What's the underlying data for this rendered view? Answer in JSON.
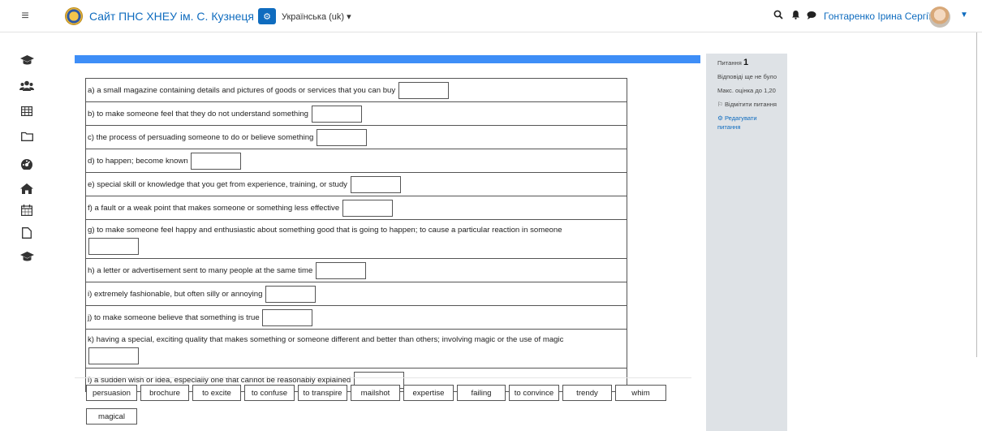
{
  "header": {
    "menu_icon": "hamburger-icon",
    "site_title": "Сайт ПНС ХНЕУ ім. С. Кузнеця",
    "language": "Українська (uk) ▾",
    "user_name": "Гонтаренко Ірина Сергіївна",
    "icons": [
      "search-icon",
      "bell-icon",
      "chat-icon",
      "chevron-down-icon"
    ]
  },
  "sidebar": {
    "icons": [
      "graduation-cap-icon",
      "users-icon",
      "grid-icon",
      "folder-icon",
      "dashboard-icon",
      "home-icon",
      "calendar-icon",
      "file-icon",
      "graduation-cap-icon"
    ]
  },
  "info": {
    "question_label": "Питання",
    "question_number": "1",
    "status": "Відповіді ще не було",
    "max_score": "Макс. оцінка до 1,20",
    "flag": "Відмітити питання",
    "edit": "Редагувати питання"
  },
  "questions": [
    "a) a small magazine containing details and pictures of goods or services that you can buy",
    "b) to make someone feel that they do not understand something",
    "c) the process of persuading someone to do or believe something",
    "d) to happen; become known",
    "e) special skill or knowledge that you get from experience, training, or study",
    "f) a fault or a weak point that makes someone or something less effective",
    "g) to make someone feel happy and enthusiastic about something good that is going to happen; to cause a particular reaction in someone",
    "h) a letter or advertisement sent to many people at the same time",
    "i) extremely fashionable, but often silly or annoying",
    "j) to make someone believe that something is true",
    "k) having a special, exciting quality that makes something or someone different and better than others; involving magic or the use  of magic",
    "l) a sudden wish or idea, especially one that cannot be reasonably explained"
  ],
  "choices": [
    "persuasion",
    "brochure",
    "to excite",
    "to confuse",
    "to transpire",
    "mailshot",
    "expertise",
    "failing",
    "to convince",
    "trendy",
    "whim",
    "magical"
  ]
}
